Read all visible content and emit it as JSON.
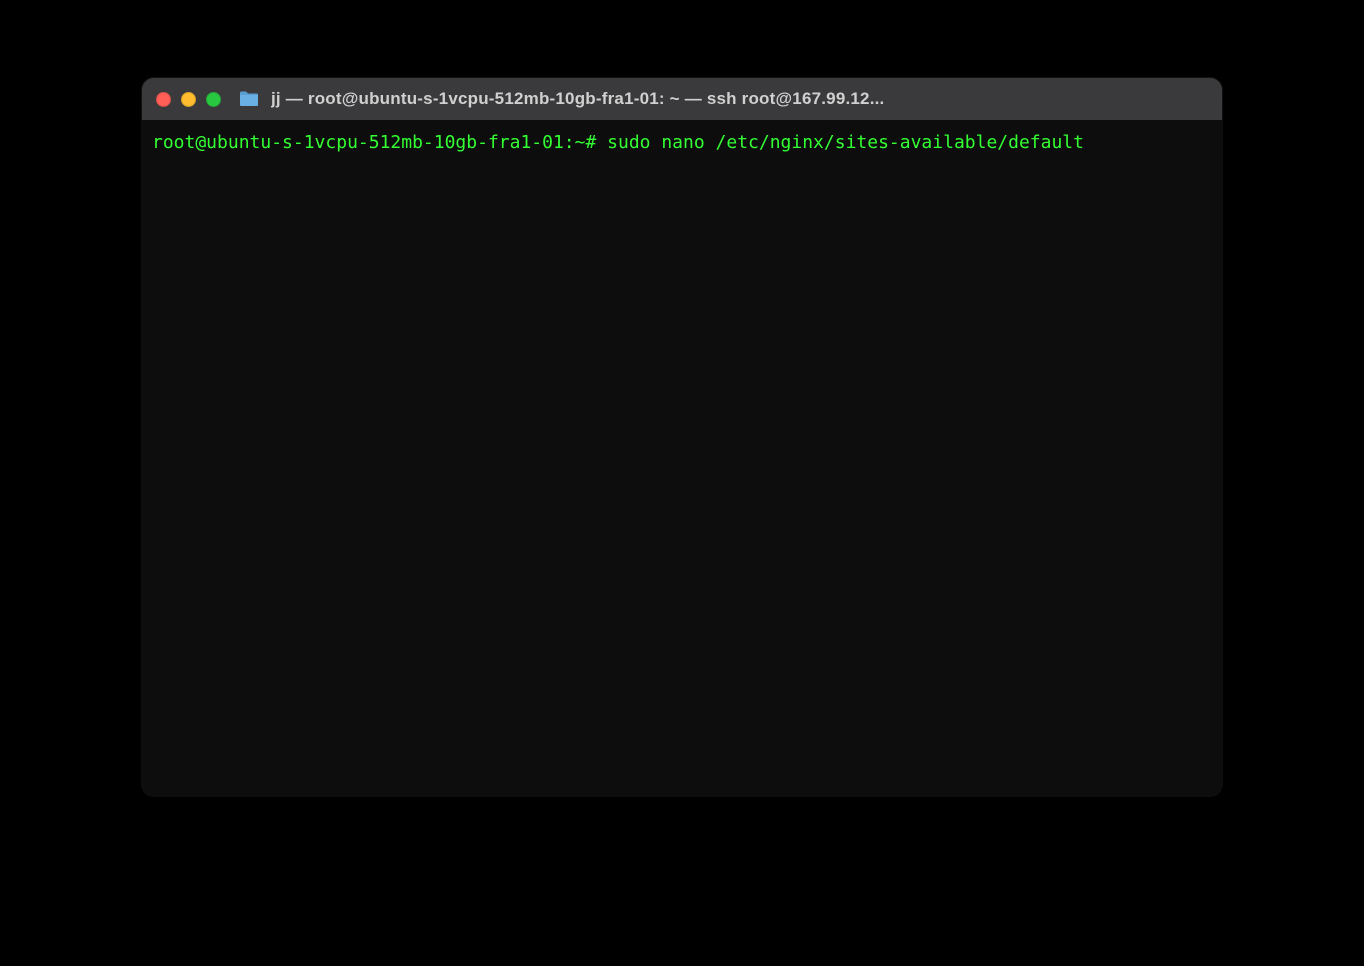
{
  "window": {
    "title": "jj — root@ubuntu-s-1vcpu-512mb-10gb-fra1-01: ~ — ssh root@167.99.12..."
  },
  "terminal": {
    "prompt": "root@ubuntu-s-1vcpu-512mb-10gb-fra1-01:~# ",
    "command": "sudo nano /etc/nginx/sites-available/default"
  },
  "colors": {
    "background": "#000000",
    "terminal_bg": "#0d0d0d",
    "titlebar_bg": "#3a3a3c",
    "text_green": "#33ff33",
    "traffic_red": "#ff5f57",
    "traffic_yellow": "#febc2e",
    "traffic_green": "#28c840"
  }
}
